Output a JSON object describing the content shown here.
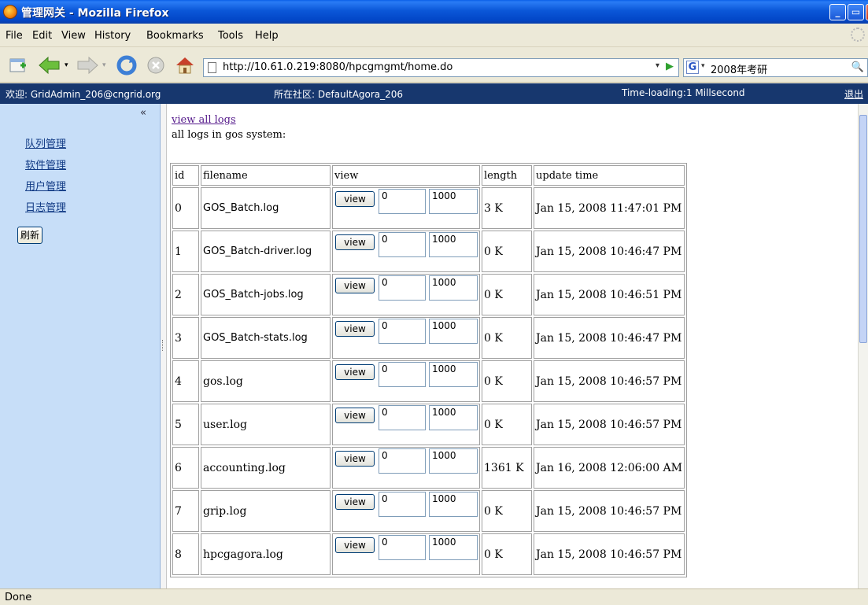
{
  "window": {
    "title": "管理网关 - Mozilla Firefox"
  },
  "menu": [
    "File",
    "Edit",
    "View",
    "History",
    "Bookmarks",
    "Tools",
    "Help"
  ],
  "address": {
    "url": "http://10.61.0.219:8080/hpcgmgmt/home.do"
  },
  "search": {
    "query": "2008年考研",
    "engine_glyph": "G"
  },
  "info": {
    "welcome": "欢迎: GridAdmin_206@cngrid.org",
    "community": "所在社区: DefaultAgora_206",
    "loading": "Time-loading:1 Millsecond",
    "logout": "退出"
  },
  "sidebar": {
    "collapse": "«",
    "items": [
      {
        "label": "队列管理"
      },
      {
        "label": "软件管理"
      },
      {
        "label": "用户管理"
      },
      {
        "label": "日志管理"
      }
    ],
    "refresh": "刷新"
  },
  "content": {
    "view_all_link": "view all logs",
    "caption": "all logs in gos system:",
    "table": {
      "headers": [
        "id",
        "filename",
        "view",
        "length",
        "update time"
      ],
      "rows": [
        {
          "id": "0",
          "filename": "GOS_Batch.log",
          "start": "0",
          "count": "1000",
          "length": "3 K",
          "updated": "Jan 15, 2008 11:47:01 PM"
        },
        {
          "id": "1",
          "filename": "GOS_Batch-driver.log",
          "start": "0",
          "count": "1000",
          "length": "0 K",
          "updated": "Jan 15, 2008 10:46:47 PM"
        },
        {
          "id": "2",
          "filename": "GOS_Batch-jobs.log",
          "start": "0",
          "count": "1000",
          "length": "0 K",
          "updated": "Jan 15, 2008 10:46:51 PM"
        },
        {
          "id": "3",
          "filename": "GOS_Batch-stats.log",
          "start": "0",
          "count": "1000",
          "length": "0 K",
          "updated": "Jan 15, 2008 10:46:47 PM"
        },
        {
          "id": "4",
          "filename": "gos.log",
          "start": "0",
          "count": "1000",
          "length": "0 K",
          "updated": "Jan 15, 2008 10:46:57 PM"
        },
        {
          "id": "5",
          "filename": "user.log",
          "start": "0",
          "count": "1000",
          "length": "0 K",
          "updated": "Jan 15, 2008 10:46:57 PM"
        },
        {
          "id": "6",
          "filename": "accounting.log",
          "start": "0",
          "count": "1000",
          "length": "1361 K",
          "updated": "Jan 16, 2008 12:06:00 AM"
        },
        {
          "id": "7",
          "filename": "grip.log",
          "start": "0",
          "count": "1000",
          "length": "0 K",
          "updated": "Jan 15, 2008 10:46:57 PM"
        },
        {
          "id": "8",
          "filename": "hpcgagora.log",
          "start": "0",
          "count": "1000",
          "length": "0 K",
          "updated": "Jan 15, 2008 10:46:57 PM"
        }
      ],
      "view_button": "view"
    }
  },
  "status": "Done"
}
